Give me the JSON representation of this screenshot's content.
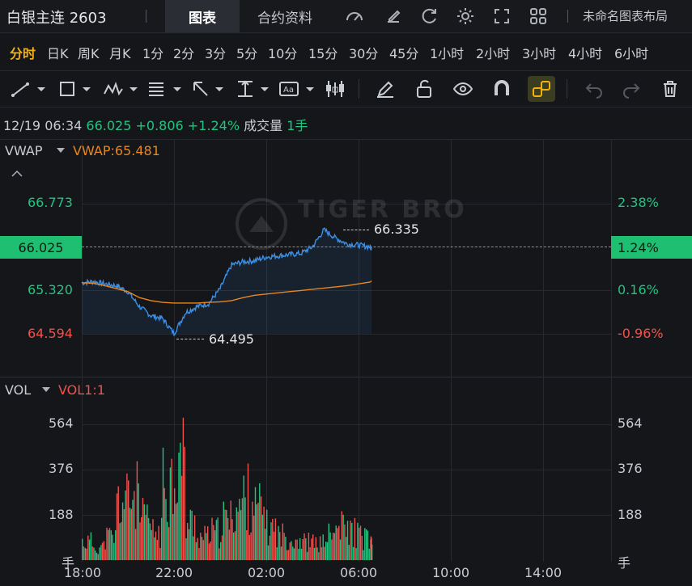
{
  "header": {
    "instrument_title": "白银主连 2603",
    "tab_chart": "图表",
    "tab_contract_info": "合约资料",
    "layout_name": "未命名图表布局",
    "icons": [
      "gauge-icon",
      "edit-icon",
      "refresh-icon",
      "settings-icon",
      "fullscreen-icon",
      "grid-icon"
    ]
  },
  "periods": {
    "active": "分时",
    "items": [
      "分时",
      "日K",
      "周K",
      "月K",
      "1分",
      "2分",
      "3分",
      "5分",
      "10分",
      "15分",
      "30分",
      "45分",
      "1小时",
      "2小时",
      "3小时",
      "4小时",
      "6小时"
    ]
  },
  "toolbar": {
    "tools": [
      "line-tool-icon",
      "rect-tool-icon",
      "pattern-tool-icon",
      "fib-tool-icon",
      "arrow-tool-icon",
      "measure-tool-icon",
      "text-tool-icon",
      "candle-tool-icon",
      "pen-icon",
      "unlock-icon",
      "eye-icon",
      "magnet-icon",
      "link-icon",
      "undo-icon",
      "redo-icon",
      "trash-icon"
    ]
  },
  "quote": {
    "datetime": "12/19 06:34",
    "price": "66.025",
    "change": "+0.806",
    "change_pct": "+1.24%",
    "volume_label": "成交量",
    "volume_value": "1手"
  },
  "price_panel": {
    "indicator": "VWAP",
    "indicator_value": "VWAP:65.481",
    "watermark": "TIGER BROKERS",
    "left_axis": [
      "66.773",
      "65.320",
      "64.594"
    ],
    "current_price_tag": "66.025",
    "right_axis": [
      "2.38%",
      "0.16%",
      "-0.96%"
    ],
    "current_pct_tag": "1.24%",
    "high_label": "66.335",
    "low_label": "64.495"
  },
  "volume_panel": {
    "indicator": "VOL",
    "indicator_value": "VOL1:1",
    "left_axis": [
      "564",
      "376",
      "188",
      "手"
    ],
    "right_axis": [
      "564",
      "376",
      "188",
      "手"
    ]
  },
  "x_axis": [
    "18:00",
    "22:00",
    "02:00",
    "06:00",
    "10:00",
    "14:00"
  ],
  "colors": {
    "up": "#26c281",
    "down": "#f0524e",
    "price_line": "#3d8fe6",
    "vwap_line": "#e8861f",
    "accent": "#f2b011",
    "price_tag_bg": "#1fbf72"
  },
  "chart_data": {
    "type": "line",
    "series": [
      {
        "name": "VWAP",
        "values": [
          65.45,
          65.44,
          65.4,
          65.35,
          65.3,
          65.2,
          65.15,
          65.12,
          65.11,
          65.11,
          65.11,
          65.12,
          65.13,
          65.15,
          65.2,
          65.24,
          65.26,
          65.28,
          65.3,
          65.32,
          65.34,
          65.36,
          65.38,
          65.4,
          65.43,
          65.46,
          65.48
        ]
      }
    ],
    "price_x": [
      "18:00",
      "18:30",
      "19:00",
      "19:30",
      "20:00",
      "20:30",
      "21:00",
      "21:30",
      "22:00",
      "22:30",
      "23:00",
      "23:30",
      "00:00",
      "00:30",
      "01:00",
      "01:30",
      "02:00",
      "02:30",
      "03:00",
      "03:30",
      "04:00",
      "04:30",
      "05:00",
      "05:30",
      "06:00",
      "06:30",
      "06:34"
    ],
    "price_values": [
      65.45,
      65.47,
      65.43,
      65.4,
      65.3,
      65.05,
      64.9,
      64.85,
      64.6,
      64.95,
      65.05,
      65.1,
      65.35,
      65.75,
      65.8,
      65.82,
      65.88,
      65.9,
      65.92,
      65.94,
      66.05,
      66.335,
      66.2,
      66.1,
      66.08,
      66.05,
      66.025
    ],
    "volume_values": [
      120,
      90,
      150,
      380,
      420,
      260,
      180,
      530,
      640,
      240,
      150,
      180,
      260,
      350,
      410,
      330,
      210,
      160,
      140,
      120,
      110,
      160,
      210,
      190,
      150,
      100,
      60
    ],
    "ylim_price": [
      64.4,
      67.0
    ],
    "ylim_volume": [
      0,
      700
    ]
  }
}
